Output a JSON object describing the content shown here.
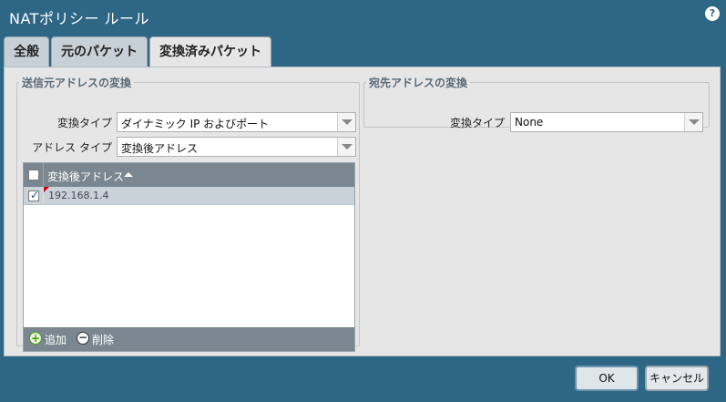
{
  "window": {
    "title": "NATポリシー ルール",
    "help_symbol": "?"
  },
  "tabs": [
    {
      "label": "全般",
      "active": false
    },
    {
      "label": "元のパケット",
      "active": false
    },
    {
      "label": "変換済みパケット",
      "active": true
    }
  ],
  "source_translation": {
    "legend": "送信元アドレスの変換",
    "translation_type_label": "変換タイプ",
    "translation_type_value": "ダイナミック IP およびポート",
    "address_type_label": "アドレス タイプ",
    "address_type_value": "変換後アドレス",
    "grid": {
      "column_header": "変換後アドレス",
      "rows": [
        {
          "value": "192.168.1.4",
          "checked": true
        }
      ],
      "add_label": "追加",
      "delete_label": "削除"
    }
  },
  "destination_translation": {
    "legend": "宛先アドレスの変換",
    "translation_type_label": "変換タイプ",
    "translation_type_value": "None"
  },
  "buttons": {
    "ok": "OK",
    "cancel": "キャンセル"
  },
  "colors": {
    "titlebar": "#2e6685",
    "panel": "#e6e6e6",
    "grid_header": "#7a8790",
    "selected_row": "#c9d2d8"
  }
}
